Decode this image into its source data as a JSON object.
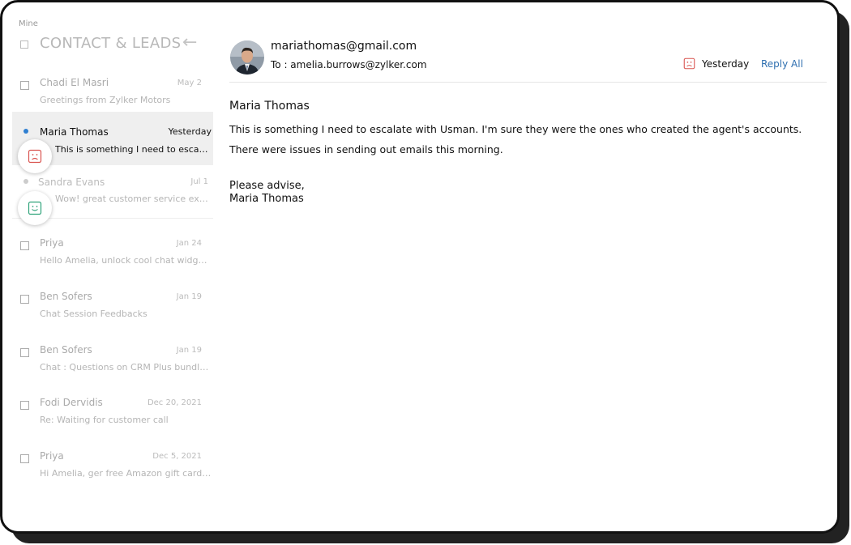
{
  "sidebar": {
    "filter_label": "Mine",
    "title": "CONTACT & LEADS",
    "back_icon": "←",
    "items": [
      {
        "name": "Chadi El Masri",
        "date": "May 2",
        "snippet": "Greetings from Zylker Motors"
      },
      {
        "name": "Maria Thomas",
        "date": "Yesterday",
        "snippet": "This is something I need to escalate with Usman. I'm sure they were the ones"
      },
      {
        "name": "Sandra Evans",
        "date": "Jul 1",
        "snippet": "Wow! great customer service experience"
      },
      {
        "name": "Priya",
        "date": "Jan 24",
        "snippet": "Hello Amelia, unlock cool chat widgets today"
      },
      {
        "name": "Ben Sofers",
        "date": "Jan 19",
        "snippet": "Chat Session Feedbacks"
      },
      {
        "name": "Ben Sofers",
        "date": "Jan 19",
        "snippet": "Chat : Questions on CRM Plus bundle pricing"
      },
      {
        "name": "Fodi Dervidis",
        "date": "Dec 20, 2021",
        "snippet": "Re: Waiting for customer call"
      },
      {
        "name": "Priya",
        "date": "Dec 5, 2021",
        "snippet": "Hi Amelia, ger free Amazon gift cards now"
      }
    ]
  },
  "sentiment": {
    "negative": {
      "icon": "sad-face-icon",
      "color": "#d9534f"
    },
    "positive": {
      "icon": "happy-face-icon",
      "color": "#2fa37a"
    }
  },
  "message": {
    "from_email": "mariathomas@gmail.com",
    "to_line": "To : amelia.burrows@zylker.com",
    "date": "Yesterday",
    "reply_all": "Reply All",
    "sender_name": "Maria Thomas",
    "body": [
      "This is something I need to escalate with Usman. I'm sure they were the ones who created the agent's accounts.",
      "There were issues in sending out emails this morning."
    ],
    "closing": "Please advise,",
    "signature": "Maria Thomas"
  }
}
